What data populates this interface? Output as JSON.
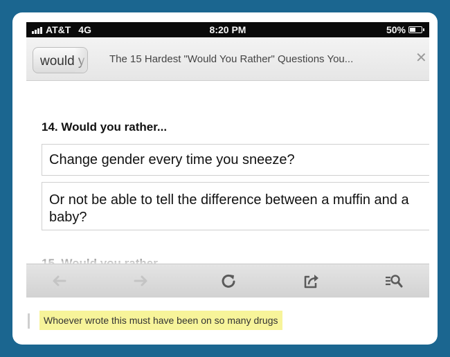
{
  "status_bar": {
    "carrier": "AT&T",
    "network": "4G",
    "time": "8:20 PM",
    "battery": "50%",
    "battery_level": 0.5
  },
  "tab_bar": {
    "url_text": "would y",
    "page_title": "The 15 Hardest \"Would You Rather\" Questions You...",
    "close_icon": "close-icon"
  },
  "content": {
    "question_heading": "14. Would you rather...",
    "answers": [
      "Change gender every time you sneeze?",
      "Or not be able to tell the difference between a muffin and a baby?"
    ],
    "next_heading": "15. Would you rather..."
  },
  "toolbar": {
    "icons": [
      "back-arrow-icon",
      "forward-arrow-icon",
      "reload-icon",
      "share-icon",
      "reader-search-icon"
    ],
    "disabled_color": "#c4c4c4",
    "active_color": "#5a5a5a"
  },
  "caption": {
    "text": "Whoever wrote this must have been on so many drugs",
    "highlight_color": "#f7f49a"
  },
  "colors": {
    "background": "#1b6690",
    "status_bar": "#0a0a0a"
  }
}
